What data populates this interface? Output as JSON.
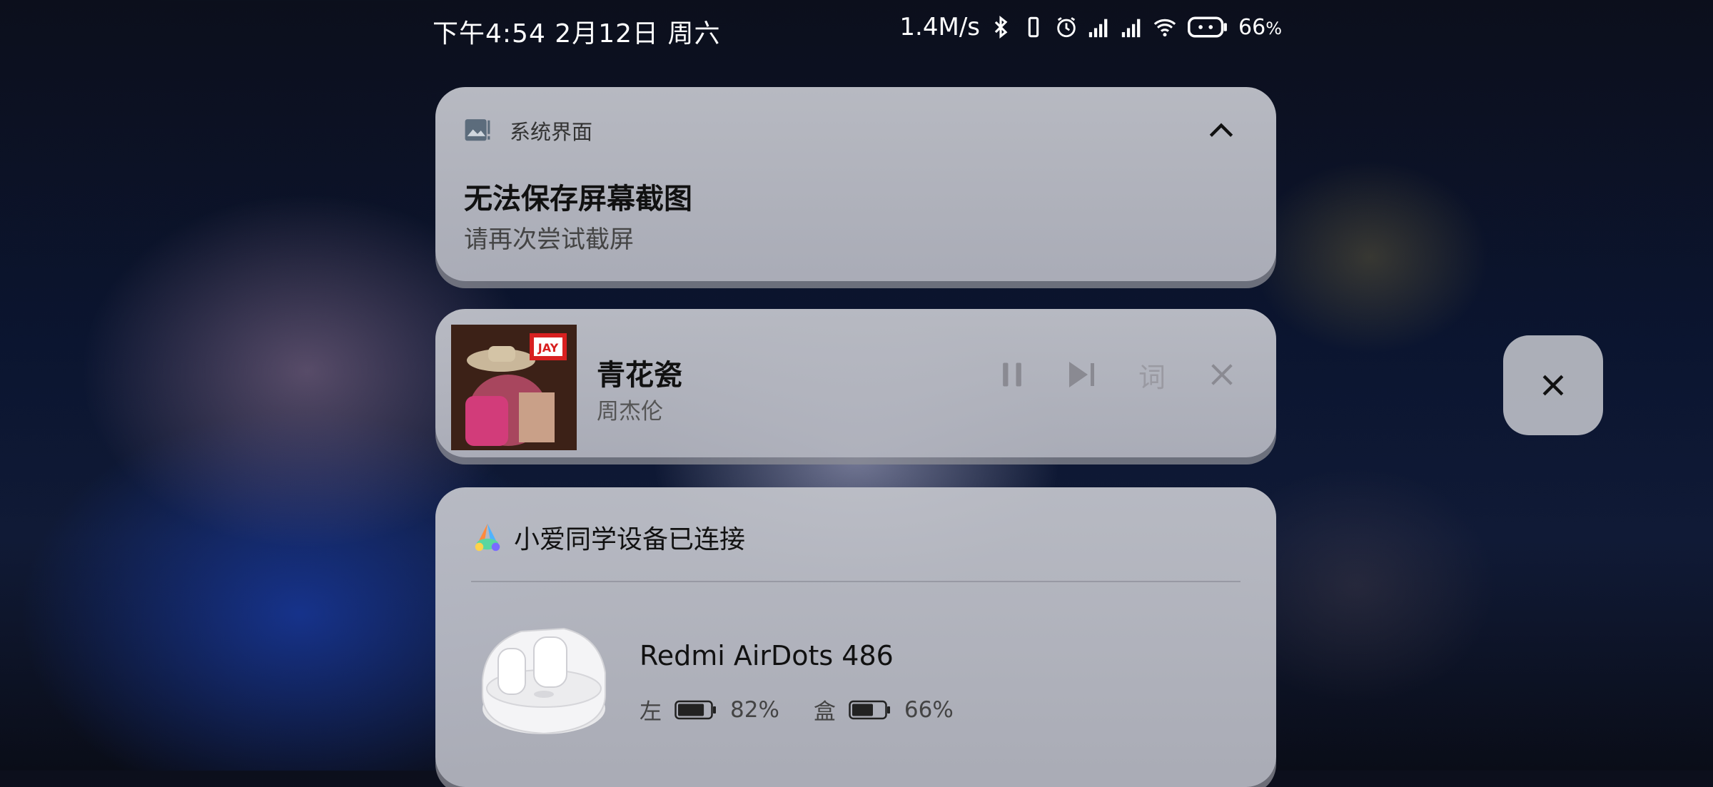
{
  "status": {
    "time_date": "下午4:54 2月12日 周六",
    "net_speed": "1.4M/s",
    "battery_pct": "66",
    "battery_unit": "%",
    "icons": [
      "bluetooth-icon",
      "vibrate-icon",
      "alarm-icon",
      "signal-icon",
      "signal-icon",
      "wifi-icon",
      "battery-icon"
    ]
  },
  "notification": {
    "app_name": "系统界面",
    "title": "无法保存屏幕截图",
    "text": "请再次尝试截屏"
  },
  "media": {
    "song": "青花瓷",
    "artist": "周杰伦",
    "album_badge": "JAY",
    "lyrics_label": "词"
  },
  "xiaoai": {
    "title": "小爱同学设备已连接",
    "device_name": "Redmi AirDots 486",
    "left_label": "左",
    "left_pct": "82%",
    "left_level": 0.82,
    "case_label": "盒",
    "case_pct": "66%",
    "case_level": 0.66
  },
  "colors": {
    "accent": "#ffffff",
    "card": "#bec0c8"
  }
}
